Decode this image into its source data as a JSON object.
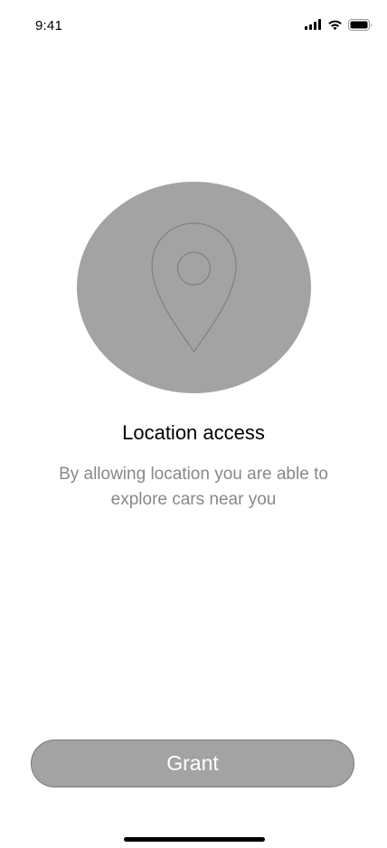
{
  "status_bar": {
    "time": "9:41",
    "icons": [
      "signal-icon",
      "wifi-icon",
      "battery-icon"
    ]
  },
  "illustration": {
    "icon": "location-pin-icon",
    "circle_color": "#a3a3a3",
    "stroke_color": "#7a7a7a"
  },
  "content": {
    "title": "Location access",
    "subtitle": "By allowing location you are able to explore cars near you"
  },
  "actions": {
    "grant_label": "Grant",
    "button_color": "#a3a3a3"
  }
}
